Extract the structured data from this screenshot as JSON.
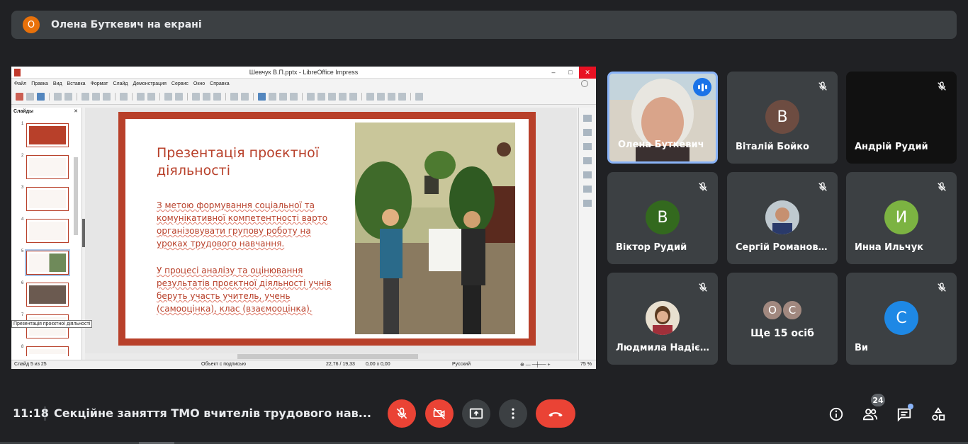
{
  "banner": {
    "avatar_letter": "О",
    "text": "Олена Буткевич на екрані"
  },
  "share": {
    "window_title": "Шевчук В.П.pptx - LibreOffice Impress",
    "window_buttons": [
      "–",
      "□",
      "✕"
    ],
    "menu": [
      "Файл",
      "Правка",
      "Вид",
      "Вставка",
      "Формат",
      "Слайд",
      "Демонстрация",
      "Сервис",
      "Окно",
      "Справка"
    ],
    "slides_pane_title": "Слайды",
    "slides_pane_close": "✕",
    "slide_numbers": [
      "1",
      "2",
      "3",
      "4",
      "5",
      "6",
      "7",
      "8"
    ],
    "tooltip": "Презентація проєктної діяльності",
    "slide": {
      "title": "Презентація проєктної діяльності",
      "para1": "З метою формування соціальної та комунікативної компетентності варто організовувати  групову роботу на уроках трудового навчання.",
      "para2": "У процесі аналізу та оцінювання результатів проєктної діяльності учнів беруть участь учитель, учень (самооцінка), клас (взаємооцінка)."
    },
    "status": {
      "slide": "Слайд 5 из 25",
      "object": "Объект с подписью",
      "pos": "22,76 / 19,33",
      "size": "0,00 x 0,00",
      "lang": "Русский",
      "zoom": "75 %"
    }
  },
  "participants": [
    {
      "name": "Олена Буткевич",
      "speaking": true
    },
    {
      "name": "Віталій Бойко",
      "avatar_letter": "В",
      "avatar_color": "#6d4c41"
    },
    {
      "name": "Андрій Рудий"
    },
    {
      "name": "Віктор Рудий",
      "avatar_letter": "В",
      "avatar_color": "#33691e"
    },
    {
      "name": "Сергій Романовс..."
    },
    {
      "name": "Инна Ильчук",
      "avatar_letter": "И",
      "avatar_color": "#7cb342"
    },
    {
      "name": "Людмила Надієв..."
    },
    {
      "others_letters": [
        "О",
        "С"
      ],
      "label": "Ще 15 осіб"
    },
    {
      "name": "Ви",
      "avatar_letter": "С",
      "avatar_color": "#1e88e5"
    }
  ],
  "bottom": {
    "time": "11:18",
    "meeting_title": "Секційне заняття ТМО вчителів трудового нав...",
    "participants_count": "24"
  }
}
